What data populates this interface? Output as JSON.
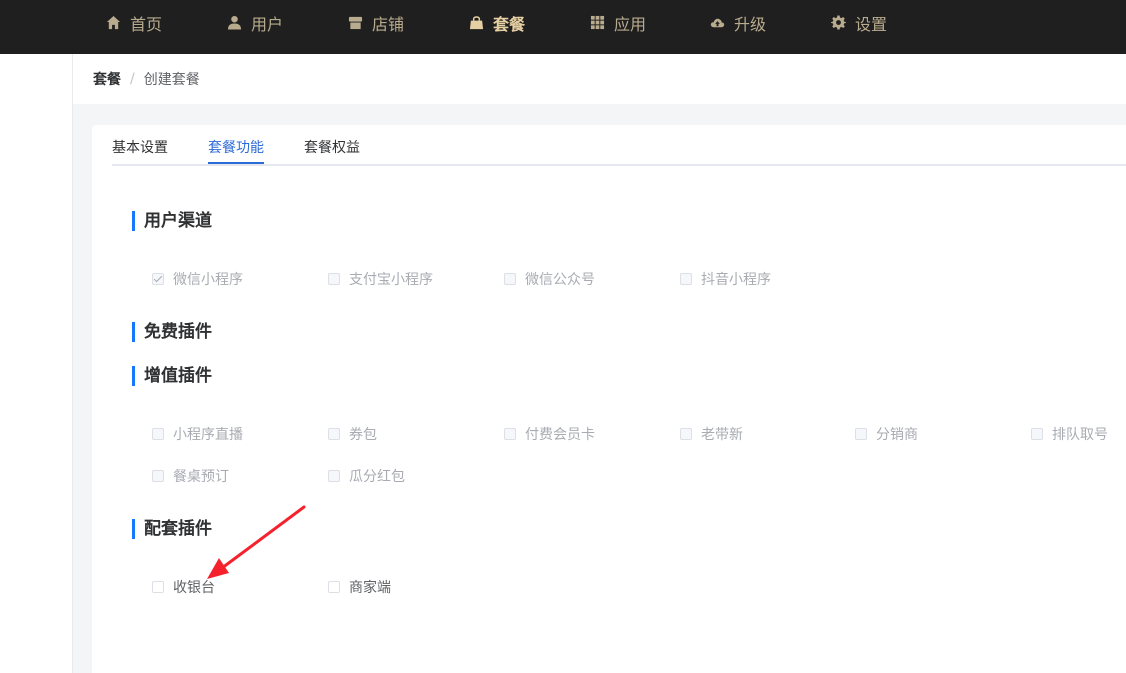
{
  "nav": {
    "items": [
      {
        "label": "首页",
        "icon": "home-icon"
      },
      {
        "label": "用户",
        "icon": "user-icon"
      },
      {
        "label": "店铺",
        "icon": "store-icon"
      },
      {
        "label": "套餐",
        "icon": "bag-icon",
        "active": true
      },
      {
        "label": "应用",
        "icon": "apps-grid-icon"
      },
      {
        "label": "升级",
        "icon": "cloud-upload-icon"
      },
      {
        "label": "设置",
        "icon": "gear-icon"
      }
    ]
  },
  "breadcrumb": {
    "root": "套餐",
    "separator": "/",
    "current": "创建套餐"
  },
  "tabs": [
    {
      "label": "基本设置"
    },
    {
      "label": "套餐功能",
      "active": true
    },
    {
      "label": "套餐权益"
    }
  ],
  "sections": {
    "user_channels": {
      "title": "用户渠道",
      "options": [
        {
          "label": "微信小程序",
          "checked": true
        },
        {
          "label": "支付宝小程序",
          "checked": false
        },
        {
          "label": "微信公众号",
          "checked": false
        },
        {
          "label": "抖音小程序",
          "checked": false
        }
      ]
    },
    "free_plugins": {
      "title": "免费插件"
    },
    "value_added_plugins": {
      "title": "增值插件",
      "options": [
        {
          "label": "小程序直播"
        },
        {
          "label": "券包"
        },
        {
          "label": "付费会员卡"
        },
        {
          "label": "老带新"
        },
        {
          "label": "分销商"
        },
        {
          "label": "排队取号"
        },
        {
          "label": "餐桌预订"
        },
        {
          "label": "瓜分红包"
        }
      ]
    },
    "supporting_plugins": {
      "title": "配套插件",
      "options": [
        {
          "label": "收银台"
        },
        {
          "label": "商家端"
        }
      ]
    }
  },
  "colors": {
    "topbar_bg": "#1f1f1f",
    "nav_text": "#b9ab8e",
    "nav_active": "#e6cfa3",
    "accent": "#2d6bd6",
    "section_bar": "#1677ff",
    "annotation_arrow": "#f5222d"
  }
}
